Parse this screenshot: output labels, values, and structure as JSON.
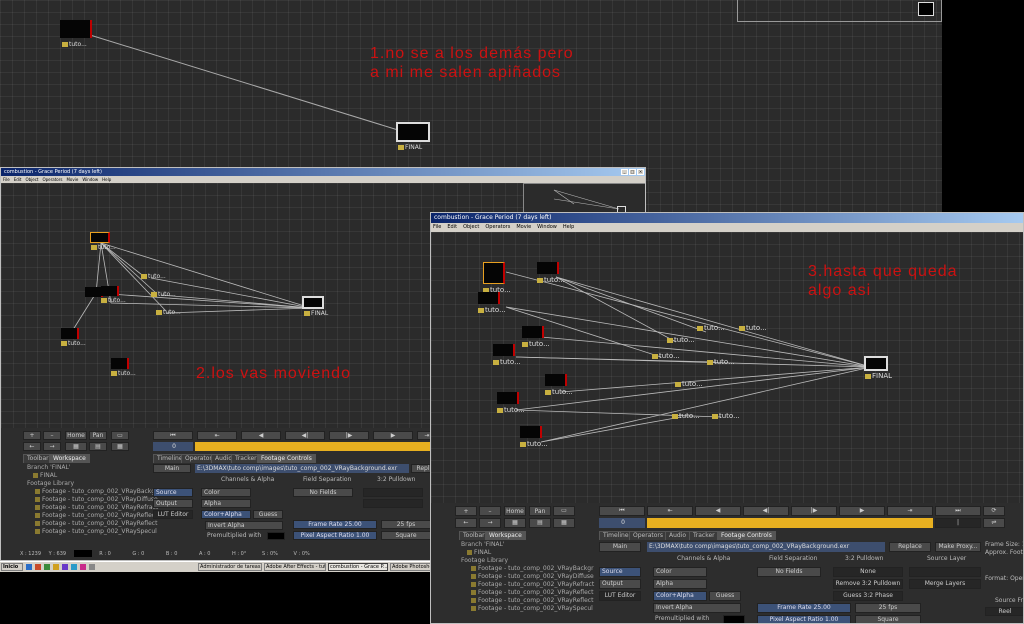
{
  "annotations": {
    "step1_line1": "1.no se a los demás pero",
    "step1_line2": "a mi me salen apiñados",
    "step2": "2.los vas moviendo",
    "step3_line1": "3.hasta que queda",
    "step3_line2": "algo asi"
  },
  "top_schematic": {
    "node_tuto_label": "tuto...",
    "node_final_label": "FINAL"
  },
  "window_mid": {
    "title": "combustion - Grace Period (7 days left)",
    "menu": [
      "File",
      "Edit",
      "Object",
      "Operators",
      "Movie",
      "Window",
      "Help"
    ],
    "node_labels": {
      "tuto": "tuto...",
      "final": "FINAL"
    },
    "view_buttons": [
      "+",
      "–",
      "Home",
      "Pan"
    ],
    "frame_value": "0",
    "tabs": [
      "Toolbar",
      "Workspace",
      "Timeline",
      "Operators",
      "Audio",
      "Tracker",
      "Footage Controls"
    ],
    "branch": "Branch 'FINAL'",
    "tree_final": "FINAL",
    "footage_library": "Footage Library",
    "footage_items": [
      "Footage - tuto_comp_002_VRayBackgr",
      "Footage - tuto_comp_002_VRayDiffuse",
      "Footage - tuto_comp_002_VRayRefract",
      "Footage - tuto_comp_002_VRayReflect",
      "Footage - tuto_comp_002_VRayReflect",
      "Footage - tuto_comp_002_VRaySpecul"
    ],
    "main_btn": "Main",
    "path": "E:\\3DMAX\\tuto comp\\images\\tuto_comp_002_VRayBackground.exr",
    "replace": "Repl",
    "channels_alpha": "Channels & Alpha",
    "field_separation": "Field Separation",
    "pulldown": "3:2 Pulldown",
    "source": "Source",
    "output": "Output",
    "lut_editor": "LUT Editor",
    "color": "Color",
    "alpha": "Alpha",
    "color_alpha": "Color+Alpha",
    "guess": "Guess",
    "no_fields": "No Fields",
    "invert_alpha": "Invert Alpha",
    "premultiplied": "Premultiplied with",
    "frame_rate": "Frame Rate 25.00",
    "fps": "25 fps",
    "pixel_aspect": "Pixel Aspect Ratio 1.00",
    "square": "Square",
    "status": {
      "x": "X : 1239",
      "y": "Y : 639",
      "r": "R : 0",
      "g": "G : 0",
      "b": "B : 0",
      "a": "A : 0",
      "h": "H : 0°",
      "s": "S : 0%",
      "v": "V : 0%"
    }
  },
  "window_right": {
    "title": "combustion - Grace Period (7 days left)",
    "menu": [
      "File",
      "Edit",
      "Object",
      "Operators",
      "Movie",
      "Window",
      "Help"
    ],
    "node_labels": {
      "tuto": "tuto...",
      "final": "FINAL"
    },
    "view_buttons": [
      "+",
      "–",
      "Home",
      "Pan"
    ],
    "frame_value": "0",
    "tabs": [
      "Toolbar",
      "Workspace",
      "Timeline",
      "Operators",
      "Audio",
      "Tracker",
      "Footage Controls"
    ],
    "branch": "Branch 'FINAL'",
    "tree_final": "FINAL",
    "footage_library": "Footage Library",
    "footage_items": [
      "Footage - tuto_comp_002_VRayBackgr",
      "Footage - tuto_comp_002_VRayDiffuse",
      "Footage - tuto_comp_002_VRayRefract",
      "Footage - tuto_comp_002_VRayReflect",
      "Footage - tuto_comp_002_VRayReflect",
      "Footage - tuto_comp_002_VRaySpecul"
    ],
    "main_btn": "Main",
    "path": "E:\\3DMAX\\tuto comp\\images\\tuto_comp_002_VRayBackground.exr",
    "replace": "Replace",
    "make_proxy": "Make Proxy...",
    "channels_alpha": "Channels & Alpha",
    "field_separation": "Field Separation",
    "pulldown": "3:2 Pulldown",
    "source_layer": "Source Layer",
    "source": "Source",
    "output": "Output",
    "lut_editor": "LUT Editor",
    "color": "Color",
    "alpha": "Alpha",
    "color_alpha": "Color+Alpha",
    "guess": "Guess",
    "no_fields": "No Fields",
    "none": "None",
    "remove_pulldown": "Remove 3:2 Pulldown",
    "guess_pulldown": "Guess 3:2 Phase",
    "merge_layers": "Merge Layers",
    "invert_alpha": "Invert Alpha",
    "premultiplied": "Premultiplied with",
    "frame_rate": "Frame Rate 25.00",
    "fps": "25 fps",
    "pixel_aspect": "Pixel Aspect Ratio 1.00",
    "square": "Square",
    "frame_size": "Frame Size: 1",
    "approx": "Approx. Foota",
    "format": "Format: Open",
    "source_fr": "Source Fr",
    "reel": "Reel"
  },
  "taskbar": {
    "start": "Inicio",
    "items": [
      "Administrador de tareas...",
      "Adobe After Effects - tut...",
      "combustion - Grace P...",
      "Adobe Photosho"
    ]
  },
  "colors": {
    "annotation": "#cc1111",
    "timeline": "#e8b020",
    "final_border": "#dddddd",
    "selected": "#e8a020"
  }
}
